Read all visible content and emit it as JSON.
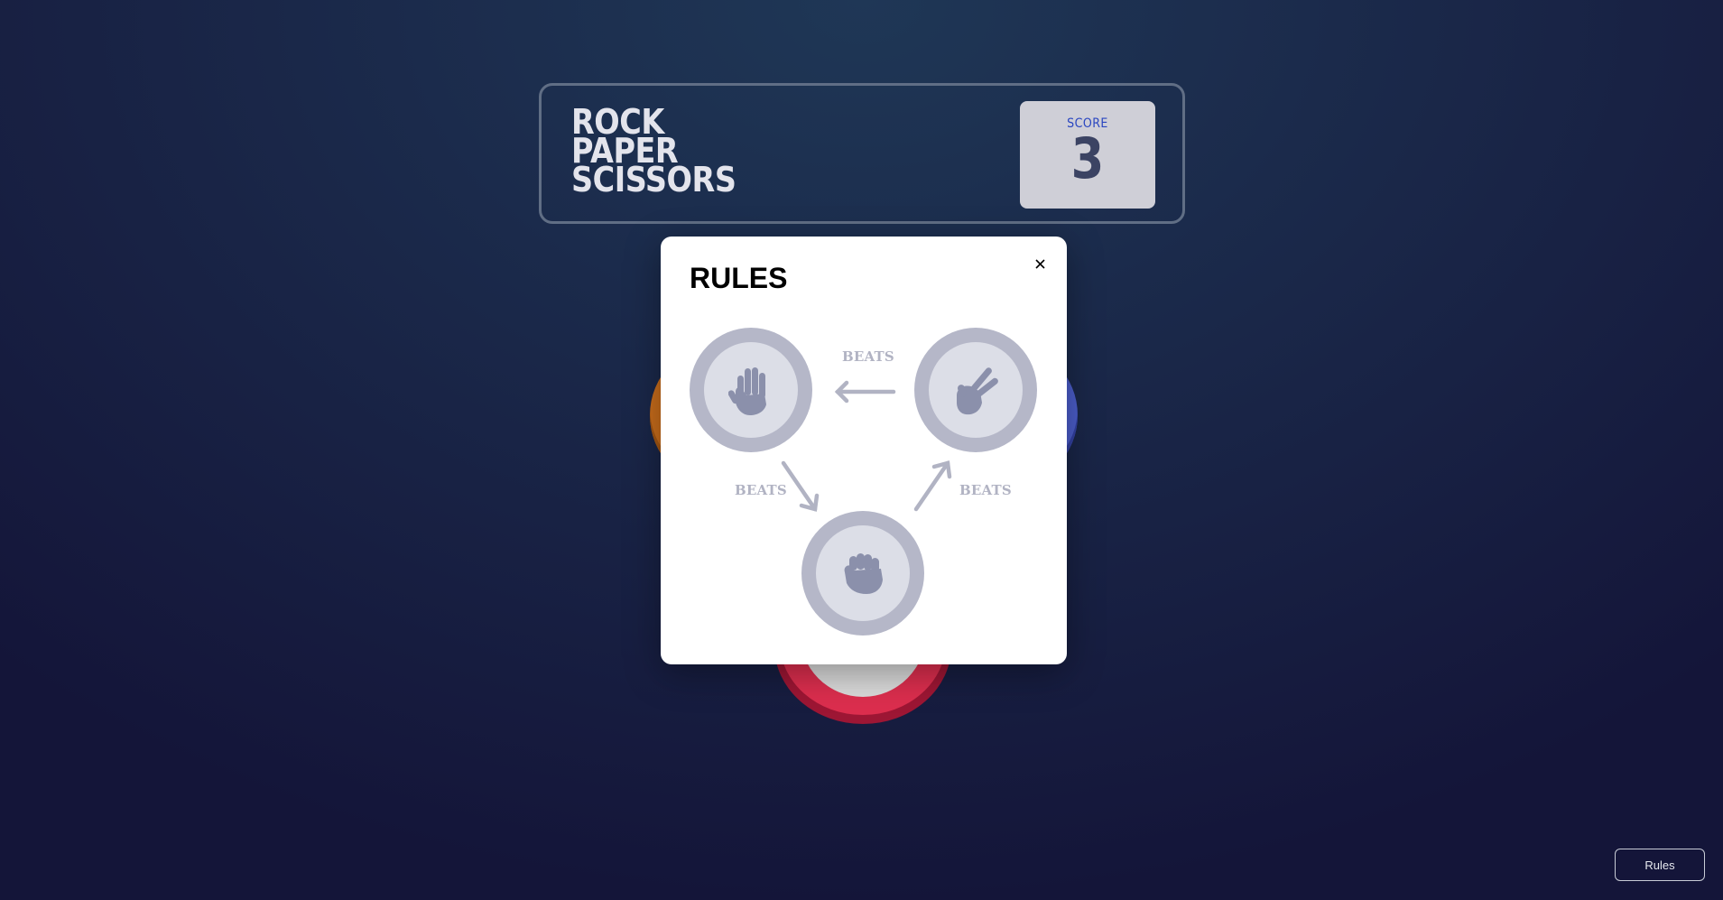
{
  "header": {
    "title_lines": [
      "ROCK",
      "PAPER",
      "SCISSORS"
    ],
    "score_label": "SCORE",
    "score_value": "3"
  },
  "modal": {
    "title": "RULES",
    "close_label": "×",
    "beats_labels": [
      "BEATS",
      "BEATS",
      "BEATS"
    ],
    "tokens": [
      {
        "name": "paper",
        "icon": "hand-paper-icon"
      },
      {
        "name": "scissors",
        "icon": "hand-scissors-icon"
      },
      {
        "name": "rock",
        "icon": "hand-rock-icon"
      }
    ]
  },
  "rules_button": {
    "label": "Rules"
  },
  "colors": {
    "background_top": "#1f3756",
    "background_bottom": "#141539",
    "score_label": "#2a46c0",
    "score_value": "#3b4363",
    "token_ring": "#b5b7c8",
    "token_inner": "#dcdee7",
    "icon_fill": "#8b90ab",
    "beats_text": "#b1b3c3",
    "paper_token": "#e8a32d",
    "scissors_token": "#4a5cc7",
    "rock_token": "#dc2e4e"
  }
}
